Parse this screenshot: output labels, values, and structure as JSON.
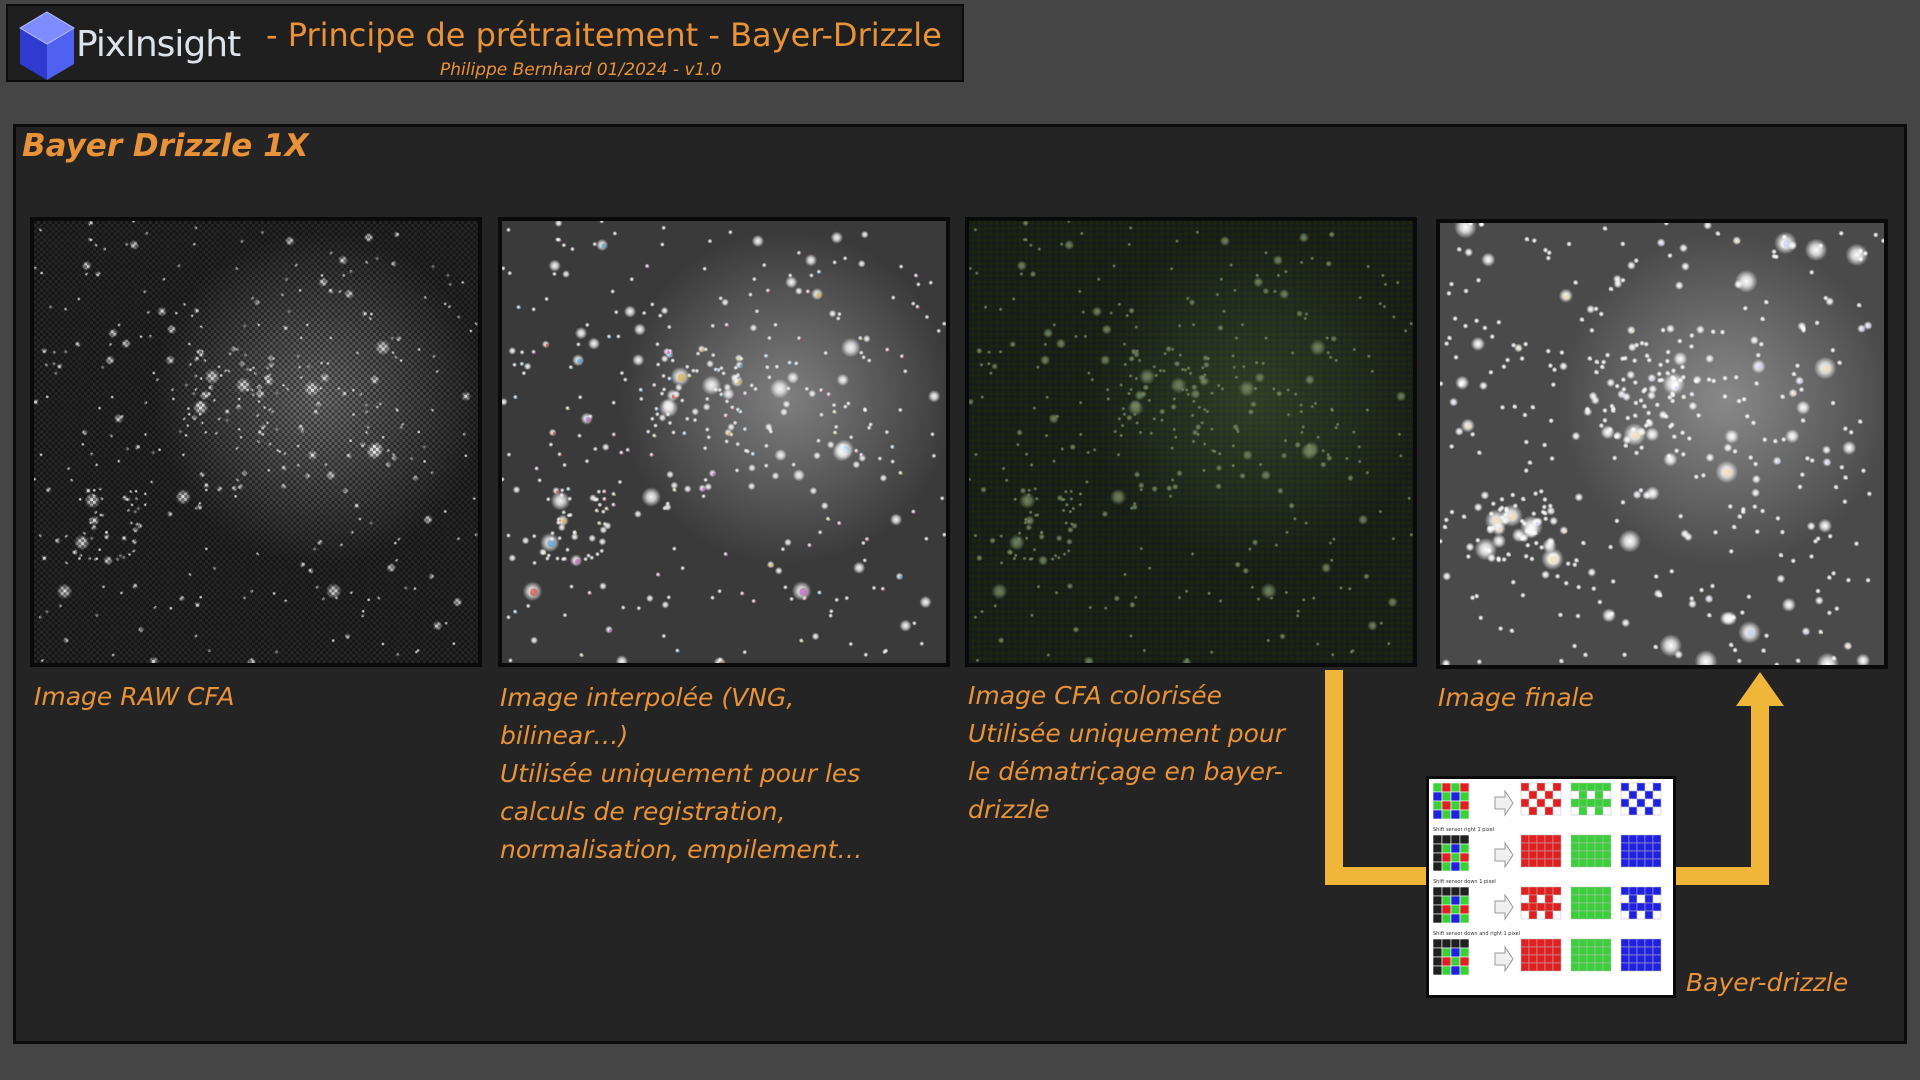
{
  "header": {
    "logo_text": "PixInsight",
    "title": "- Principe de prétraitement - Bayer-Drizzle",
    "subtitle": "Philippe Bernhard 01/2024 - v1.0"
  },
  "section": {
    "title": "Bayer Drizzle 1X"
  },
  "images": [
    {
      "caption_lines": [
        "Image RAW CFA"
      ]
    },
    {
      "caption_lines": [
        "Image interpolée (VNG,",
        "bilinear…)",
        "Utilisée uniquement pour les",
        "calculs de registration,",
        "normalisation, empilement…"
      ]
    },
    {
      "caption_lines": [
        "Image CFA colorisée",
        "Utilisée uniquement pour",
        "le dématriçage en bayer-",
        "drizzle"
      ]
    },
    {
      "caption_lines": [
        "Image finale"
      ]
    }
  ],
  "bayer_drizzle": {
    "label": "Bayer-drizzle",
    "row_captions": [
      "Shift sensor right 1 pixel",
      "Shift sensor down 1 pixel",
      "Shift sensor down and right 1 pixel"
    ]
  },
  "colors": {
    "accent": "#e8923a",
    "arrow": "#f0b63a",
    "panel_bg": "#242424",
    "page_bg": "#454545"
  }
}
